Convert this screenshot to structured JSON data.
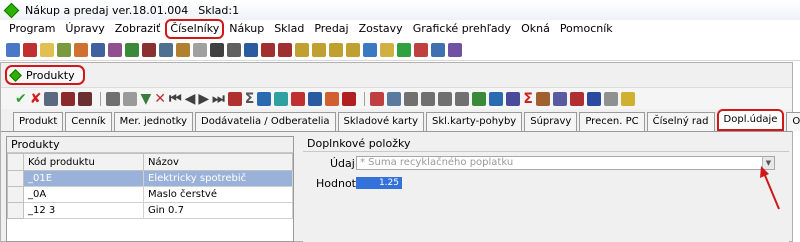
{
  "window": {
    "title": "Nákup a predaj ver.18.01.004",
    "sklad": "Sklad:1"
  },
  "menu": [
    {
      "label": "Program",
      "circled": false
    },
    {
      "label": "Úpravy",
      "circled": false
    },
    {
      "label": "Zobraziť",
      "circled": false
    },
    {
      "label": "Číselníky",
      "circled": true
    },
    {
      "label": "Nákup",
      "circled": false
    },
    {
      "label": "Sklad",
      "circled": false
    },
    {
      "label": "Predaj",
      "circled": false
    },
    {
      "label": "Zostavy",
      "circled": false
    },
    {
      "label": "Grafické prehľady",
      "circled": false
    },
    {
      "label": "Okná",
      "circled": false
    },
    {
      "label": "Pomocník",
      "circled": false
    }
  ],
  "document_tab": {
    "label": "Produkty"
  },
  "module_tabs": [
    {
      "label": "Produkt",
      "active": false
    },
    {
      "label": "Cenník",
      "active": false
    },
    {
      "label": "Mer. jednotky",
      "active": false
    },
    {
      "label": "Dodávatelia / Odberatelia",
      "active": false
    },
    {
      "label": "Skladové karty",
      "active": false
    },
    {
      "label": "Skl.karty-pohyby",
      "active": false
    },
    {
      "label": "Súpravy",
      "active": false
    },
    {
      "label": "Precen. PC",
      "active": false
    },
    {
      "label": "Číselný rad",
      "active": false
    },
    {
      "label": "Dopl.údaje",
      "active": true
    },
    {
      "label": "Obrázok",
      "active": false
    }
  ],
  "products_panel": {
    "title": "Produkty",
    "columns": [
      "Kód produktu",
      "Názov"
    ],
    "rows": [
      {
        "code": "_01E",
        "name": "Elektricky spotrebič",
        "selected": true
      },
      {
        "code": "_0A",
        "name": "Maslo čerstvé",
        "selected": false
      },
      {
        "code": "_12 3",
        "name": "Gin  0.7",
        "selected": false
      }
    ]
  },
  "additional_panel": {
    "title": "Doplnkové položky",
    "udaj_label": "Údaj",
    "udaj_value": "* Suma recyklačného poplatku",
    "hodnota_label": "Hodnota",
    "hodnota_value": "1.25"
  },
  "colors": {
    "annotation": "#d01818",
    "selection": "#9ab1d9",
    "value_highlight": "#3471d8"
  }
}
